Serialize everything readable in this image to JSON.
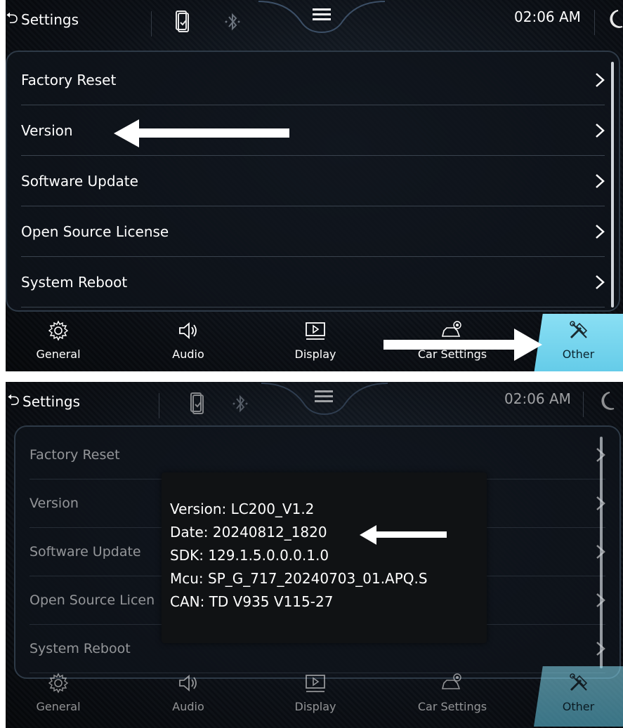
{
  "topbar": {
    "back_label_s1": "Settings",
    "back_label_s2": "Settings",
    "time": "02:06 AM"
  },
  "list": {
    "items": [
      {
        "label": "Factory Reset"
      },
      {
        "label": "Version"
      },
      {
        "label": "Software Update"
      },
      {
        "label": "Open Source License"
      },
      {
        "label": "System Reboot"
      }
    ],
    "items_s2_open_source": "Open Source Licen"
  },
  "nav": {
    "items": [
      {
        "label": "General",
        "icon": "gear-icon"
      },
      {
        "label": "Audio",
        "icon": "speaker-icon"
      },
      {
        "label": "Display",
        "icon": "display-icon"
      },
      {
        "label": "Car Settings",
        "icon": "car-gear-icon"
      },
      {
        "label": "Other",
        "icon": "tools-icon",
        "active": true
      }
    ],
    "active_color": "#70d3ec"
  },
  "version_popup": {
    "version": "Version: LC200_V1.2",
    "date": "Date: 20240812_1820",
    "sdk": "SDK: 129.1.5.0.0.0.1.0",
    "mcu": "Mcu: SP_G_717_20240703_01.APQ.S",
    "can": "CAN: TD V935 V115-27"
  }
}
